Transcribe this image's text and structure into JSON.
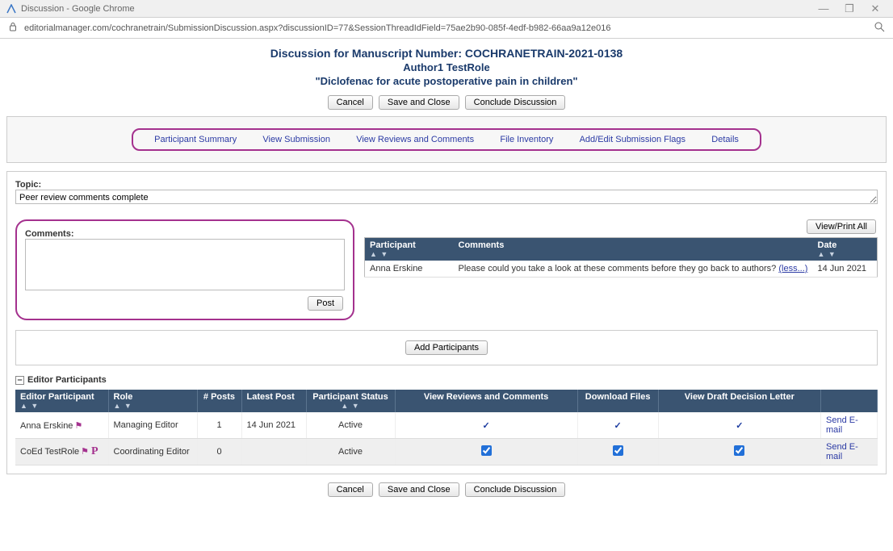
{
  "window": {
    "title": "Discussion - Google Chrome",
    "url": "editorialmanager.com/cochranetrain/SubmissionDiscussion.aspx?discussionID=77&SessionThreadIdField=75ae2b90-085f-4edf-b982-66aa9a12e016"
  },
  "header": {
    "line1": "Discussion for Manuscript Number: COCHRANETRAIN-2021-0138",
    "line2": "Author1 TestRole",
    "line3": "\"Diclofenac for acute postoperative pain in children\""
  },
  "buttons": {
    "cancel": "Cancel",
    "saveClose": "Save and Close",
    "conclude": "Conclude Discussion",
    "post": "Post",
    "viewPrintAll": "View/Print All",
    "addParticipants": "Add Participants"
  },
  "links": {
    "participantSummary": "Participant Summary",
    "viewSubmission": "View Submission",
    "viewReviewsComments": "View Reviews and Comments",
    "fileInventory": "File Inventory",
    "addEditFlags": "Add/Edit Submission Flags",
    "details": "Details",
    "less": "(less...)",
    "sendEmail": "Send E-mail"
  },
  "labels": {
    "topic": "Topic:",
    "comments": "Comments:",
    "editorParticipants": "Editor Participants"
  },
  "fields": {
    "topicValue": "Peer review comments complete",
    "commentsValue": ""
  },
  "commentsTable": {
    "headers": {
      "participant": "Participant",
      "comments": "Comments",
      "date": "Date"
    },
    "rows": [
      {
        "participant": "Anna Erskine",
        "comment": "Please could you take a look at these comments before they go back to authors? ",
        "date": "14 Jun 2021"
      }
    ]
  },
  "participantsTable": {
    "headers": {
      "editorParticipant": "Editor Participant",
      "role": "Role",
      "posts": "# Posts",
      "latestPost": "Latest Post",
      "status": "Participant Status",
      "viewReviews": "View Reviews and Comments",
      "downloadFiles": "Download Files",
      "viewDraft": "View Draft Decision Letter"
    },
    "rows": [
      {
        "name": "Anna Erskine",
        "hasFlag": true,
        "hasP": false,
        "role": "Managing Editor",
        "posts": "1",
        "latest": "14 Jun 2021",
        "status": "Active",
        "reviewsCheck": "tick",
        "downloadCheck": "tick",
        "draftCheck": "tick"
      },
      {
        "name": "CoEd TestRole",
        "hasFlag": true,
        "hasP": true,
        "role": "Coordinating Editor",
        "posts": "0",
        "latest": "",
        "status": "Active",
        "reviewsCheck": "box",
        "downloadCheck": "box",
        "draftCheck": "box"
      }
    ]
  }
}
